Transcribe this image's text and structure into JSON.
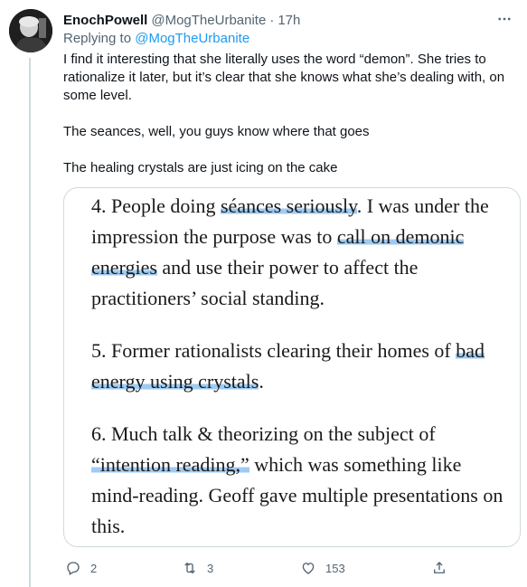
{
  "tweet": {
    "display_name": "EnochPowell",
    "handle": "@MogTheUrbanite",
    "separator": "·",
    "time": "17h",
    "replying_prefix": "Replying to",
    "replying_to": "@MogTheUrbanite",
    "body": [
      "I find it interesting that she literally uses the word “demon”. She tries to rationalize it later, but it’s clear that she knows what she’s dealing with, on some level.",
      "The seances, well, you guys know where that goes",
      "The healing crystals are just icing on the cake"
    ]
  },
  "image_text": {
    "item4": {
      "a": "4. People doing ",
      "h1": "séances seriously",
      "b": ". I was under the impression the purpose was to ",
      "h2": "call on demonic energies",
      "c": " and use their power to affect the practitioners’ social standing."
    },
    "item5": {
      "a": "5. Former rationalists clearing their homes of ",
      "h1": "bad energy using crystals",
      "b": "."
    },
    "item6": {
      "a": "6. Much talk & theorizing on the subject of ",
      "h1": "“intention reading,”",
      "b": " which was something like mind-reading. Geoff gave multiple presentations on this."
    }
  },
  "actions": {
    "reply_count": "2",
    "retweet_count": "3",
    "like_count": "153"
  },
  "icons": {
    "reply": "reply-icon",
    "retweet": "retweet-icon",
    "like": "heart-icon",
    "share": "share-icon",
    "more": "more-icon"
  },
  "colors": {
    "link": "#1d9bf0",
    "secondary_text": "#536471",
    "highlight": "#50a0e6"
  }
}
